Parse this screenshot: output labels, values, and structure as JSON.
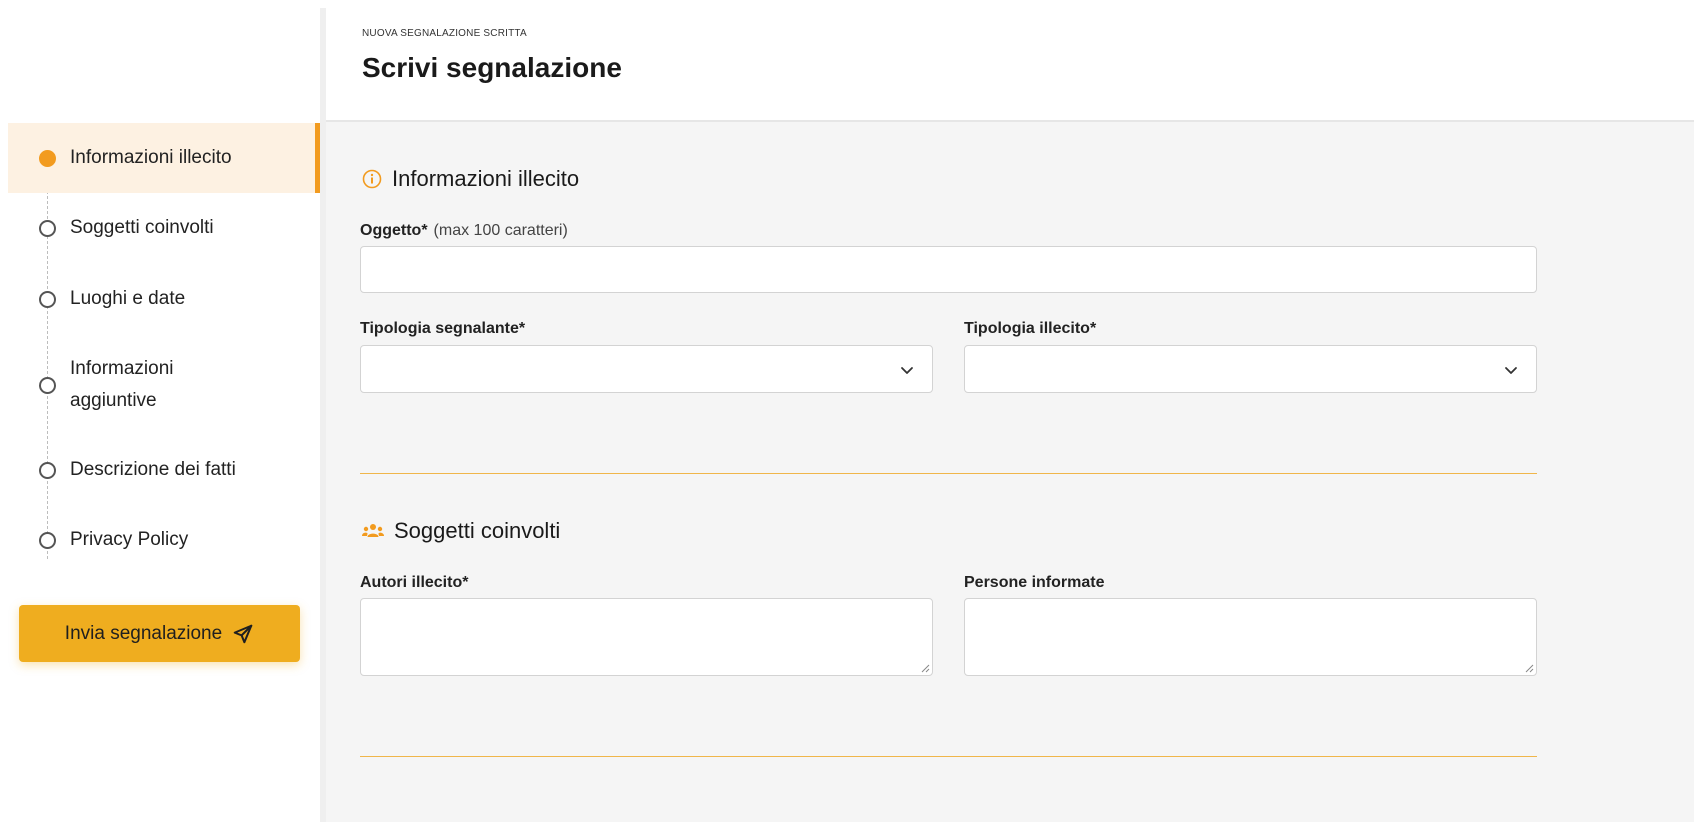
{
  "sidebar": {
    "steps": [
      {
        "label": "Informazioni illecito",
        "active": true
      },
      {
        "label": "Soggetti coinvolti",
        "active": false
      },
      {
        "label": "Luoghi e date",
        "active": false
      },
      {
        "label": "Informazioni aggiuntive",
        "line1": "Informazioni",
        "line2": "aggiuntive",
        "active": false
      },
      {
        "label": "Descrizione dei fatti",
        "active": false
      },
      {
        "label": "Privacy Policy",
        "active": false
      }
    ],
    "send_button": {
      "label": "Invia segnalazione",
      "icon": "send-icon"
    }
  },
  "header": {
    "eyebrow": "NUOVA SEGNALAZIONE SCRITTA",
    "title": "Scrivi segnalazione"
  },
  "form": {
    "section1": {
      "title": "Informazioni illecito",
      "icon": "info-icon",
      "oggetto": {
        "label": "Oggetto*",
        "hint": "(max 100 caratteri)",
        "value": ""
      },
      "tipologia_segnalante": {
        "label": "Tipologia segnalante*",
        "value": ""
      },
      "tipologia_illecito": {
        "label": "Tipologia illecito*",
        "value": ""
      }
    },
    "section2": {
      "title": "Soggetti coinvolti",
      "icon": "people-icon",
      "autori": {
        "label": "Autori illecito*",
        "value": ""
      },
      "persone": {
        "label": "Persone informate",
        "value": ""
      }
    }
  },
  "colors": {
    "accent": "#f29b1f",
    "button": "#efad1f",
    "active_bg": "#fdf1e2",
    "divider": "#f0b64a"
  }
}
